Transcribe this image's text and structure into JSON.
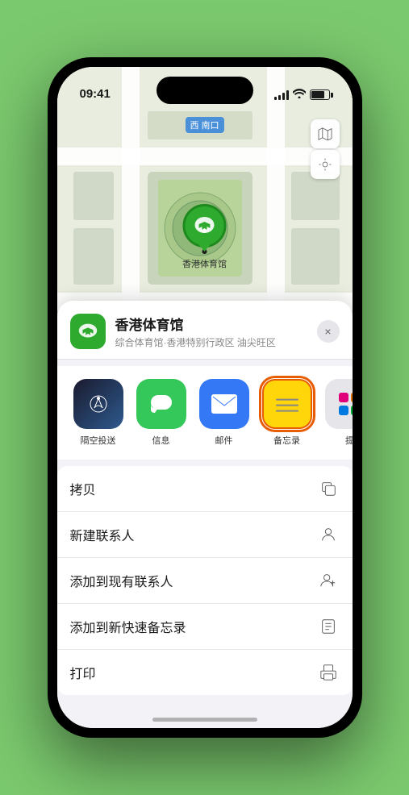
{
  "status_bar": {
    "time": "09:41",
    "signal": "signal",
    "wifi": "wifi",
    "battery": "battery"
  },
  "map": {
    "label": "南口",
    "label_prefix": "西 南口"
  },
  "venue": {
    "pin_emoji": "🏟",
    "pin_label": "香港体育馆",
    "logo_emoji": "🏟",
    "name": "香港体育馆",
    "description": "综合体育馆·香港特别行政区 油尖旺区",
    "close_icon": "×"
  },
  "share_actions": [
    {
      "id": "airdrop",
      "label": "隔空投送",
      "type": "airdrop"
    },
    {
      "id": "messages",
      "label": "信息",
      "type": "messages"
    },
    {
      "id": "mail",
      "label": "邮件",
      "type": "mail"
    },
    {
      "id": "notes",
      "label": "备忘录",
      "type": "notes"
    },
    {
      "id": "more",
      "label": "提",
      "type": "more"
    }
  ],
  "action_items": [
    {
      "id": "copy",
      "label": "拷贝",
      "icon": "copy"
    },
    {
      "id": "new-contact",
      "label": "新建联系人",
      "icon": "person-add"
    },
    {
      "id": "add-existing",
      "label": "添加到现有联系人",
      "icon": "person-plus"
    },
    {
      "id": "add-notes",
      "label": "添加到新快速备忘录",
      "icon": "note"
    },
    {
      "id": "print",
      "label": "打印",
      "icon": "print"
    }
  ]
}
